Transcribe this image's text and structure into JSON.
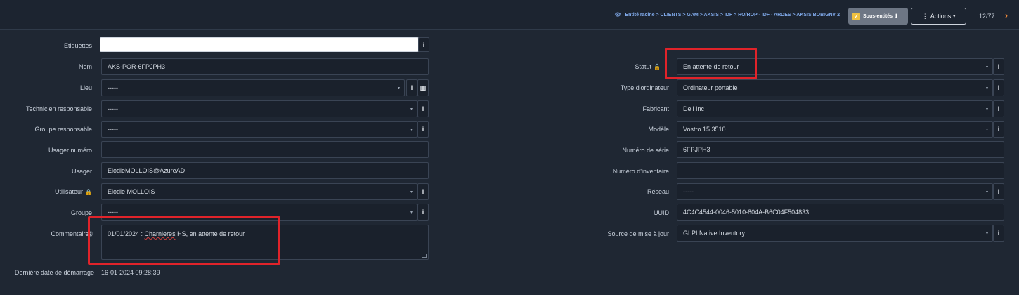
{
  "header": {
    "breadcrumb": "Entité racine > CLIENTS > GAM > AKSIS > IDF > RO/ROP - IDF - ARDES > AKSIS BOBIGNY 2",
    "sub_entities_label": "Sous-entités",
    "actions_label": "Actions",
    "pager": "12/77"
  },
  "left": {
    "etiquettes": {
      "label": "Etiquettes",
      "value": ""
    },
    "nom": {
      "label": "Nom",
      "value": "AKS-POR-6FPJPH3"
    },
    "lieu": {
      "label": "Lieu",
      "value": "-----"
    },
    "technicien": {
      "label": "Technicien responsable",
      "value": "-----"
    },
    "groupe_resp": {
      "label": "Groupe responsable",
      "value": "-----"
    },
    "usager_numero": {
      "label": "Usager numéro",
      "value": ""
    },
    "usager": {
      "label": "Usager",
      "value": "ElodieMOLLOIS@AzureAD"
    },
    "utilisateur": {
      "label": "Utilisateur",
      "value": "Elodie MOLLOIS"
    },
    "groupe": {
      "label": "Groupe",
      "value": "-----"
    },
    "commentaires": {
      "label": "Commentaires",
      "value_prefix": "01/01/2024 : ",
      "value_word": "Charnieres",
      "value_suffix": " HS, en attente de retour"
    },
    "derniere_date": {
      "label": "Dernière date de démarrage",
      "value": "16-01-2024 09:28:39"
    }
  },
  "right": {
    "statut": {
      "label": "Statut",
      "value": "En attente de retour"
    },
    "type": {
      "label": "Type d'ordinateur",
      "value": "Ordinateur portable"
    },
    "fabricant": {
      "label": "Fabricant",
      "value": "Dell Inc"
    },
    "modele": {
      "label": "Modèle",
      "value": "Vostro 15 3510"
    },
    "numero_serie": {
      "label": "Numéro de série",
      "value": "6FPJPH3"
    },
    "numero_inventaire": {
      "label": "Numéro d'inventaire",
      "value": ""
    },
    "reseau": {
      "label": "Réseau",
      "value": "-----"
    },
    "uuid": {
      "label": "UUID",
      "value": "4C4C4544-0046-5010-804A-B6C04F504833"
    },
    "source": {
      "label": "Source de mise à jour",
      "value": "GLPI Native Inventory"
    }
  },
  "icons": {
    "info": "i",
    "caret": "▾",
    "lock": "🔒",
    "map": "map-icon",
    "eye": "eye-icon"
  },
  "colors": {
    "highlight": "#e0232a",
    "accent": "#f08a3c",
    "link": "#7fa8e8"
  }
}
